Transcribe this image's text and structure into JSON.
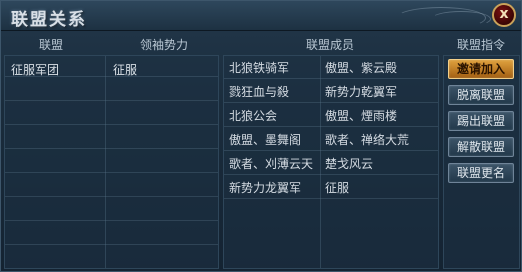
{
  "window": {
    "title": "联盟关系",
    "close_label": "x"
  },
  "headers": {
    "alliance": "联盟",
    "leader": "领袖势力",
    "members": "联盟成员",
    "commands": "联盟指令"
  },
  "alliances": [
    {
      "alliance": "征服军团",
      "leader": "征服"
    }
  ],
  "members": [
    [
      "北狼铁骑军",
      "傲盟、紫云殿"
    ],
    [
      "戮狂血与殺",
      "新势力乾翼军"
    ],
    [
      "北狼公会",
      "傲盟、煙雨楼"
    ],
    [
      "傲盟、墨舞阁",
      "歌者、禅络大荒"
    ],
    [
      "歌者、刈薄云天",
      "楚戈风云"
    ],
    [
      "新势力龙翼军",
      "征服"
    ]
  ],
  "commands": [
    {
      "label": "邀请加入",
      "active": true
    },
    {
      "label": "脱离联盟",
      "active": false
    },
    {
      "label": "踢出联盟",
      "active": false
    },
    {
      "label": "解散联盟",
      "active": false
    },
    {
      "label": "联盟更名",
      "active": false
    }
  ]
}
